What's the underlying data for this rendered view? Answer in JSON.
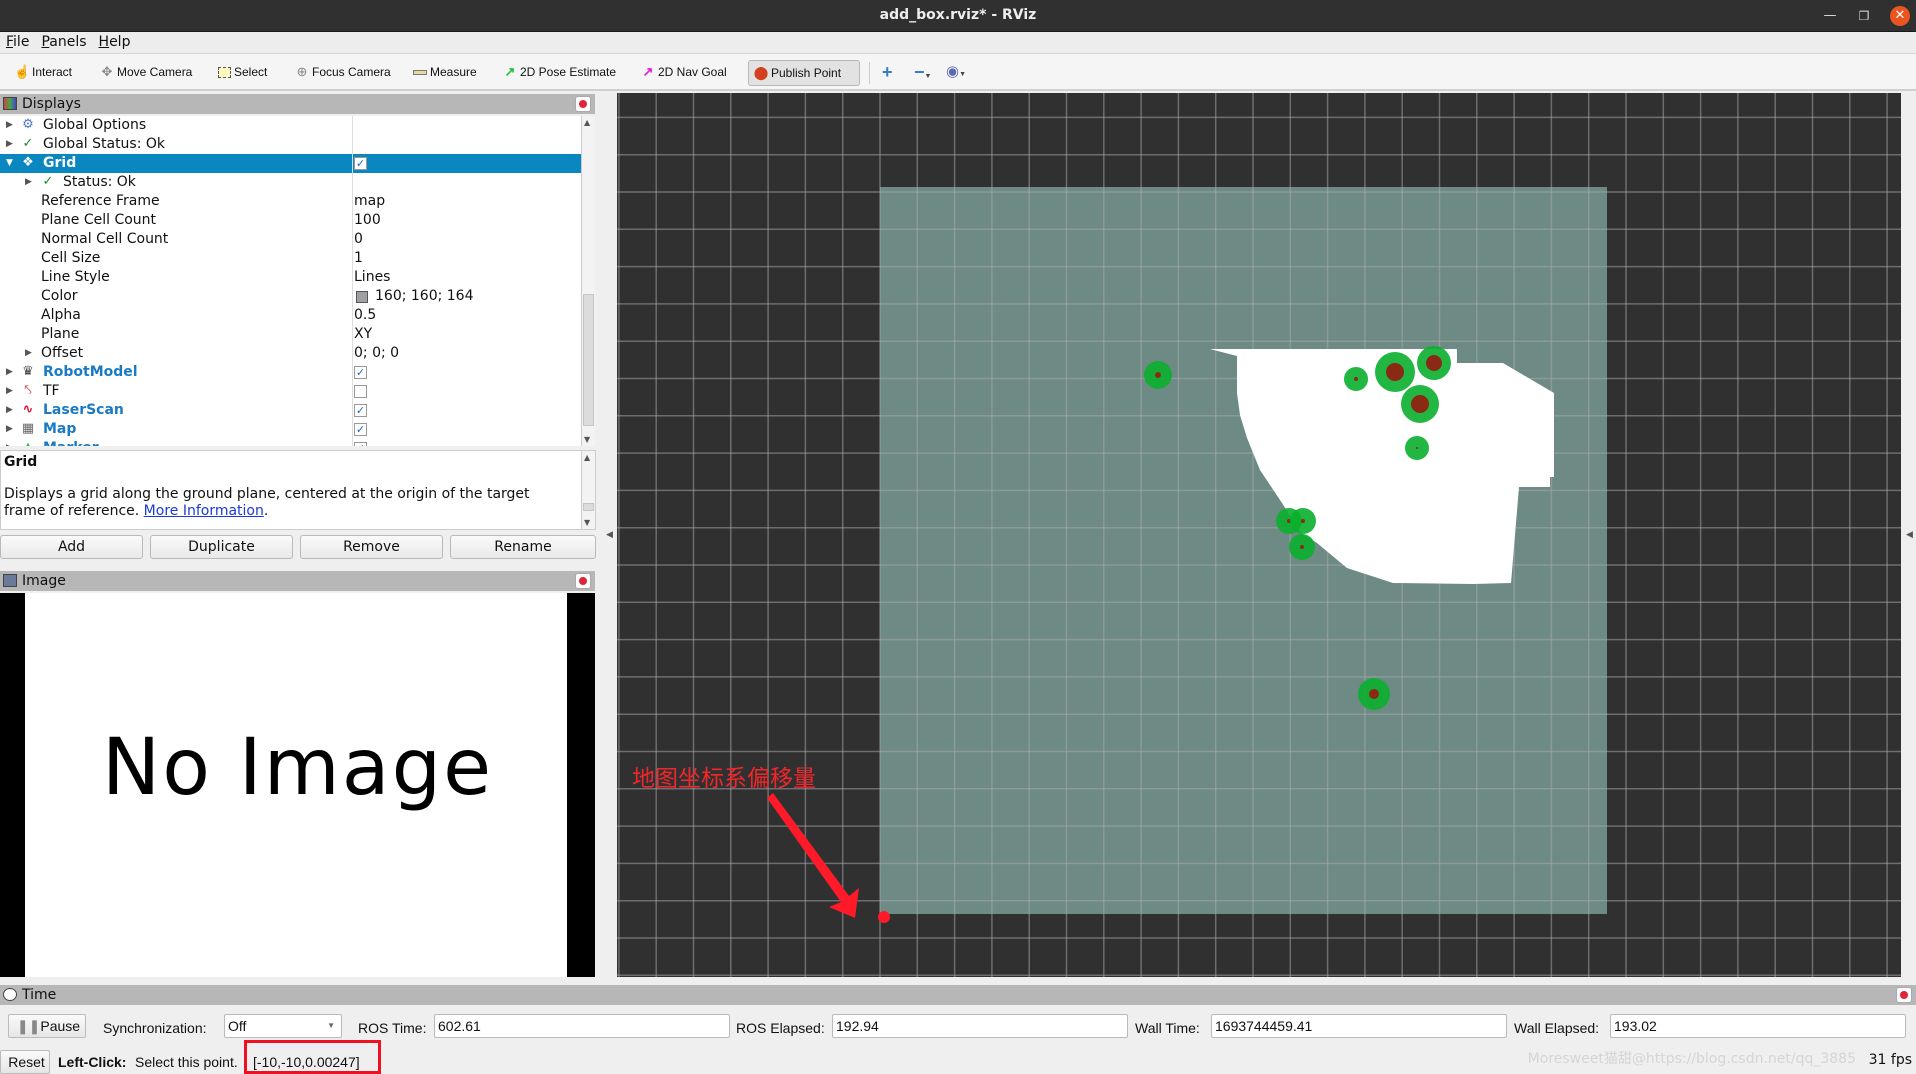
{
  "window": {
    "title": "add_box.rviz* - RViz"
  },
  "menu": [
    "File",
    "Panels",
    "Help"
  ],
  "toolbar": {
    "tools": [
      {
        "label": "Interact",
        "icon": "hand-icon"
      },
      {
        "label": "Move Camera",
        "icon": "move-camera-icon"
      },
      {
        "label": "Select",
        "icon": "select-icon"
      },
      {
        "label": "Focus Camera",
        "icon": "focus-camera-icon"
      },
      {
        "label": "Measure",
        "icon": "ruler-icon"
      },
      {
        "label": "2D Pose Estimate",
        "icon": "green-arrow-icon"
      },
      {
        "label": "2D Nav Goal",
        "icon": "pink-arrow-icon"
      },
      {
        "label": "Publish Point",
        "icon": "map-pin-icon",
        "active": true
      }
    ],
    "extra": [
      "plus-icon",
      "minus-icon",
      "eye-icon"
    ]
  },
  "displays": {
    "title": "Displays",
    "rows": [
      {
        "label": "Global Options",
        "value": ""
      },
      {
        "label": "Global Status: Ok",
        "value": ""
      },
      {
        "label": "Grid",
        "checked": true
      },
      {
        "label": "Status: Ok",
        "value": ""
      },
      {
        "label": "Reference Frame",
        "value": "map"
      },
      {
        "label": "Plane Cell Count",
        "value": "100"
      },
      {
        "label": "Normal Cell Count",
        "value": "0"
      },
      {
        "label": "Cell Size",
        "value": "1"
      },
      {
        "label": "Line Style",
        "value": "Lines"
      },
      {
        "label": "Color",
        "value": "160; 160; 164",
        "swatch": "#a0a0a4"
      },
      {
        "label": "Alpha",
        "value": "0.5"
      },
      {
        "label": "Plane",
        "value": "XY"
      },
      {
        "label": "Offset",
        "value": "0; 0; 0"
      },
      {
        "label": "RobotModel",
        "checked": true
      },
      {
        "label": "TF",
        "checked": false
      },
      {
        "label": "LaserScan",
        "checked": true
      },
      {
        "label": "Map",
        "checked": true
      },
      {
        "label": "Marker",
        "checked": true
      }
    ]
  },
  "description": {
    "title": "Grid",
    "text": "Displays a grid along the ground plane, centered at the origin of the target frame of reference. ",
    "link": "More Information",
    "after": "."
  },
  "buttons": {
    "add": "Add",
    "duplicate": "Duplicate",
    "remove": "Remove",
    "rename": "Rename"
  },
  "image_panel": {
    "title": "Image",
    "placeholder": "No Image"
  },
  "annotation": {
    "text": "地图坐标系偏移量",
    "color": "#f0262b"
  },
  "time": {
    "title": "Time",
    "pause": "Pause",
    "sync_label": "Synchronization:",
    "sync_value": "Off",
    "ros_time_label": "ROS Time:",
    "ros_time": "602.61",
    "ros_elapsed_label": "ROS Elapsed:",
    "ros_elapsed": "192.94",
    "wall_time_label": "Wall Time:",
    "wall_time": "1693744459.41",
    "wall_elapsed_label": "Wall Elapsed:",
    "wall_elapsed": "193.02"
  },
  "status": {
    "reset": "Reset",
    "hint_bold": "Left-Click:",
    "hint": "Select this point.",
    "coords": "[-10,-10,0.00247]",
    "watermark": "Moresweet猫甜@https://blog.csdn.net/qq_3885",
    "fps": "31 fps"
  },
  "colors": {
    "accent": "#0a87c0",
    "view_bg": "#303030",
    "map_fill": "#6e8a85",
    "marker_green": "#0aa02a",
    "marker_red": "#8b2a14"
  }
}
